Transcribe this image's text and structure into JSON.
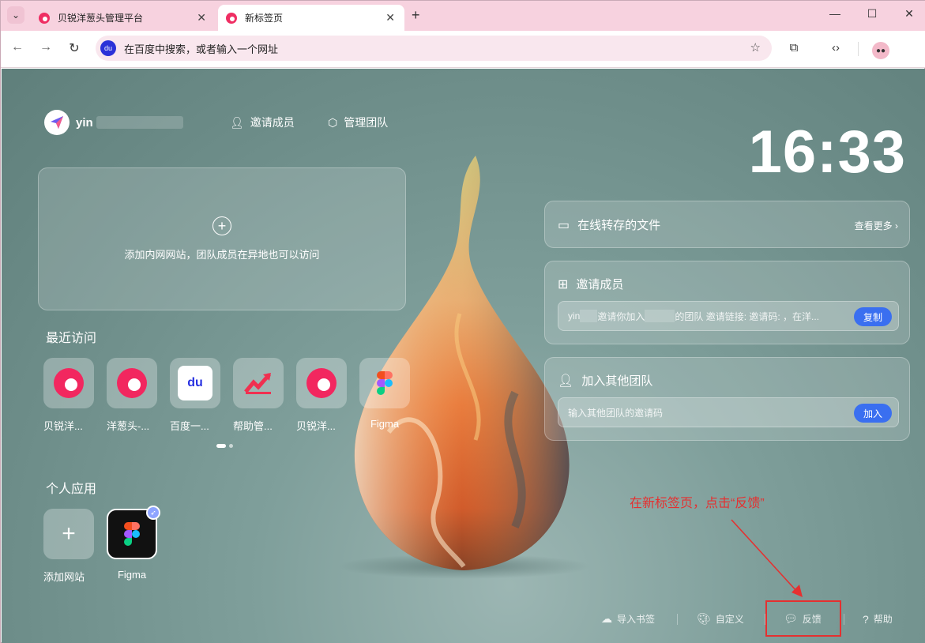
{
  "browser": {
    "tabs": [
      {
        "title": "贝锐洋葱头管理平台",
        "active": false
      },
      {
        "title": "新标签页",
        "active": true
      }
    ],
    "address_bar": {
      "placeholder": "在百度中搜索，或者输入一个网址"
    }
  },
  "header": {
    "username": "yin",
    "invite_label": "邀请成员",
    "manage_label": "管理团队"
  },
  "clock": "16:33",
  "add_site_card": {
    "text": "添加内网网站，团队成员在异地也可以访问"
  },
  "recent": {
    "title": "最近访问",
    "items": [
      {
        "label": "贝锐洋...",
        "icon": "peanut-logo-icon"
      },
      {
        "label": "洋葱头-...",
        "icon": "peanut-logo-icon"
      },
      {
        "label": "百度一...",
        "icon": "baidu-icon"
      },
      {
        "label": "帮助管...",
        "icon": "chart-trend-icon"
      },
      {
        "label": "贝锐洋...",
        "icon": "peanut-logo-icon"
      },
      {
        "label": "Figma",
        "icon": "figma-icon"
      }
    ]
  },
  "personal_apps": {
    "title": "个人应用",
    "items": [
      {
        "label": "添加网站",
        "icon": "plus-icon"
      },
      {
        "label": "Figma",
        "icon": "figma-icon"
      }
    ]
  },
  "files_card": {
    "title": "在线转存的文件",
    "more": "查看更多"
  },
  "invite_card": {
    "title": "邀请成员",
    "text_a": "yin",
    "text_b": "邀请你加入",
    "text_c": "的团队 邀请链接: 邀请码: ，在洋...",
    "button": "复制"
  },
  "join_card": {
    "title": "加入其他团队",
    "placeholder": "输入其他团队的邀请码",
    "button": "加入"
  },
  "annotation": {
    "text": "在新标签页，点击“反馈”",
    "color": "#e53030"
  },
  "footer": {
    "import": "导入书签",
    "customize": "自定义",
    "feedback": "反馈",
    "help": "帮助"
  },
  "colors": {
    "accent": "#3a6ff0",
    "brand": "#f2275f",
    "annotation": "#e53030"
  }
}
